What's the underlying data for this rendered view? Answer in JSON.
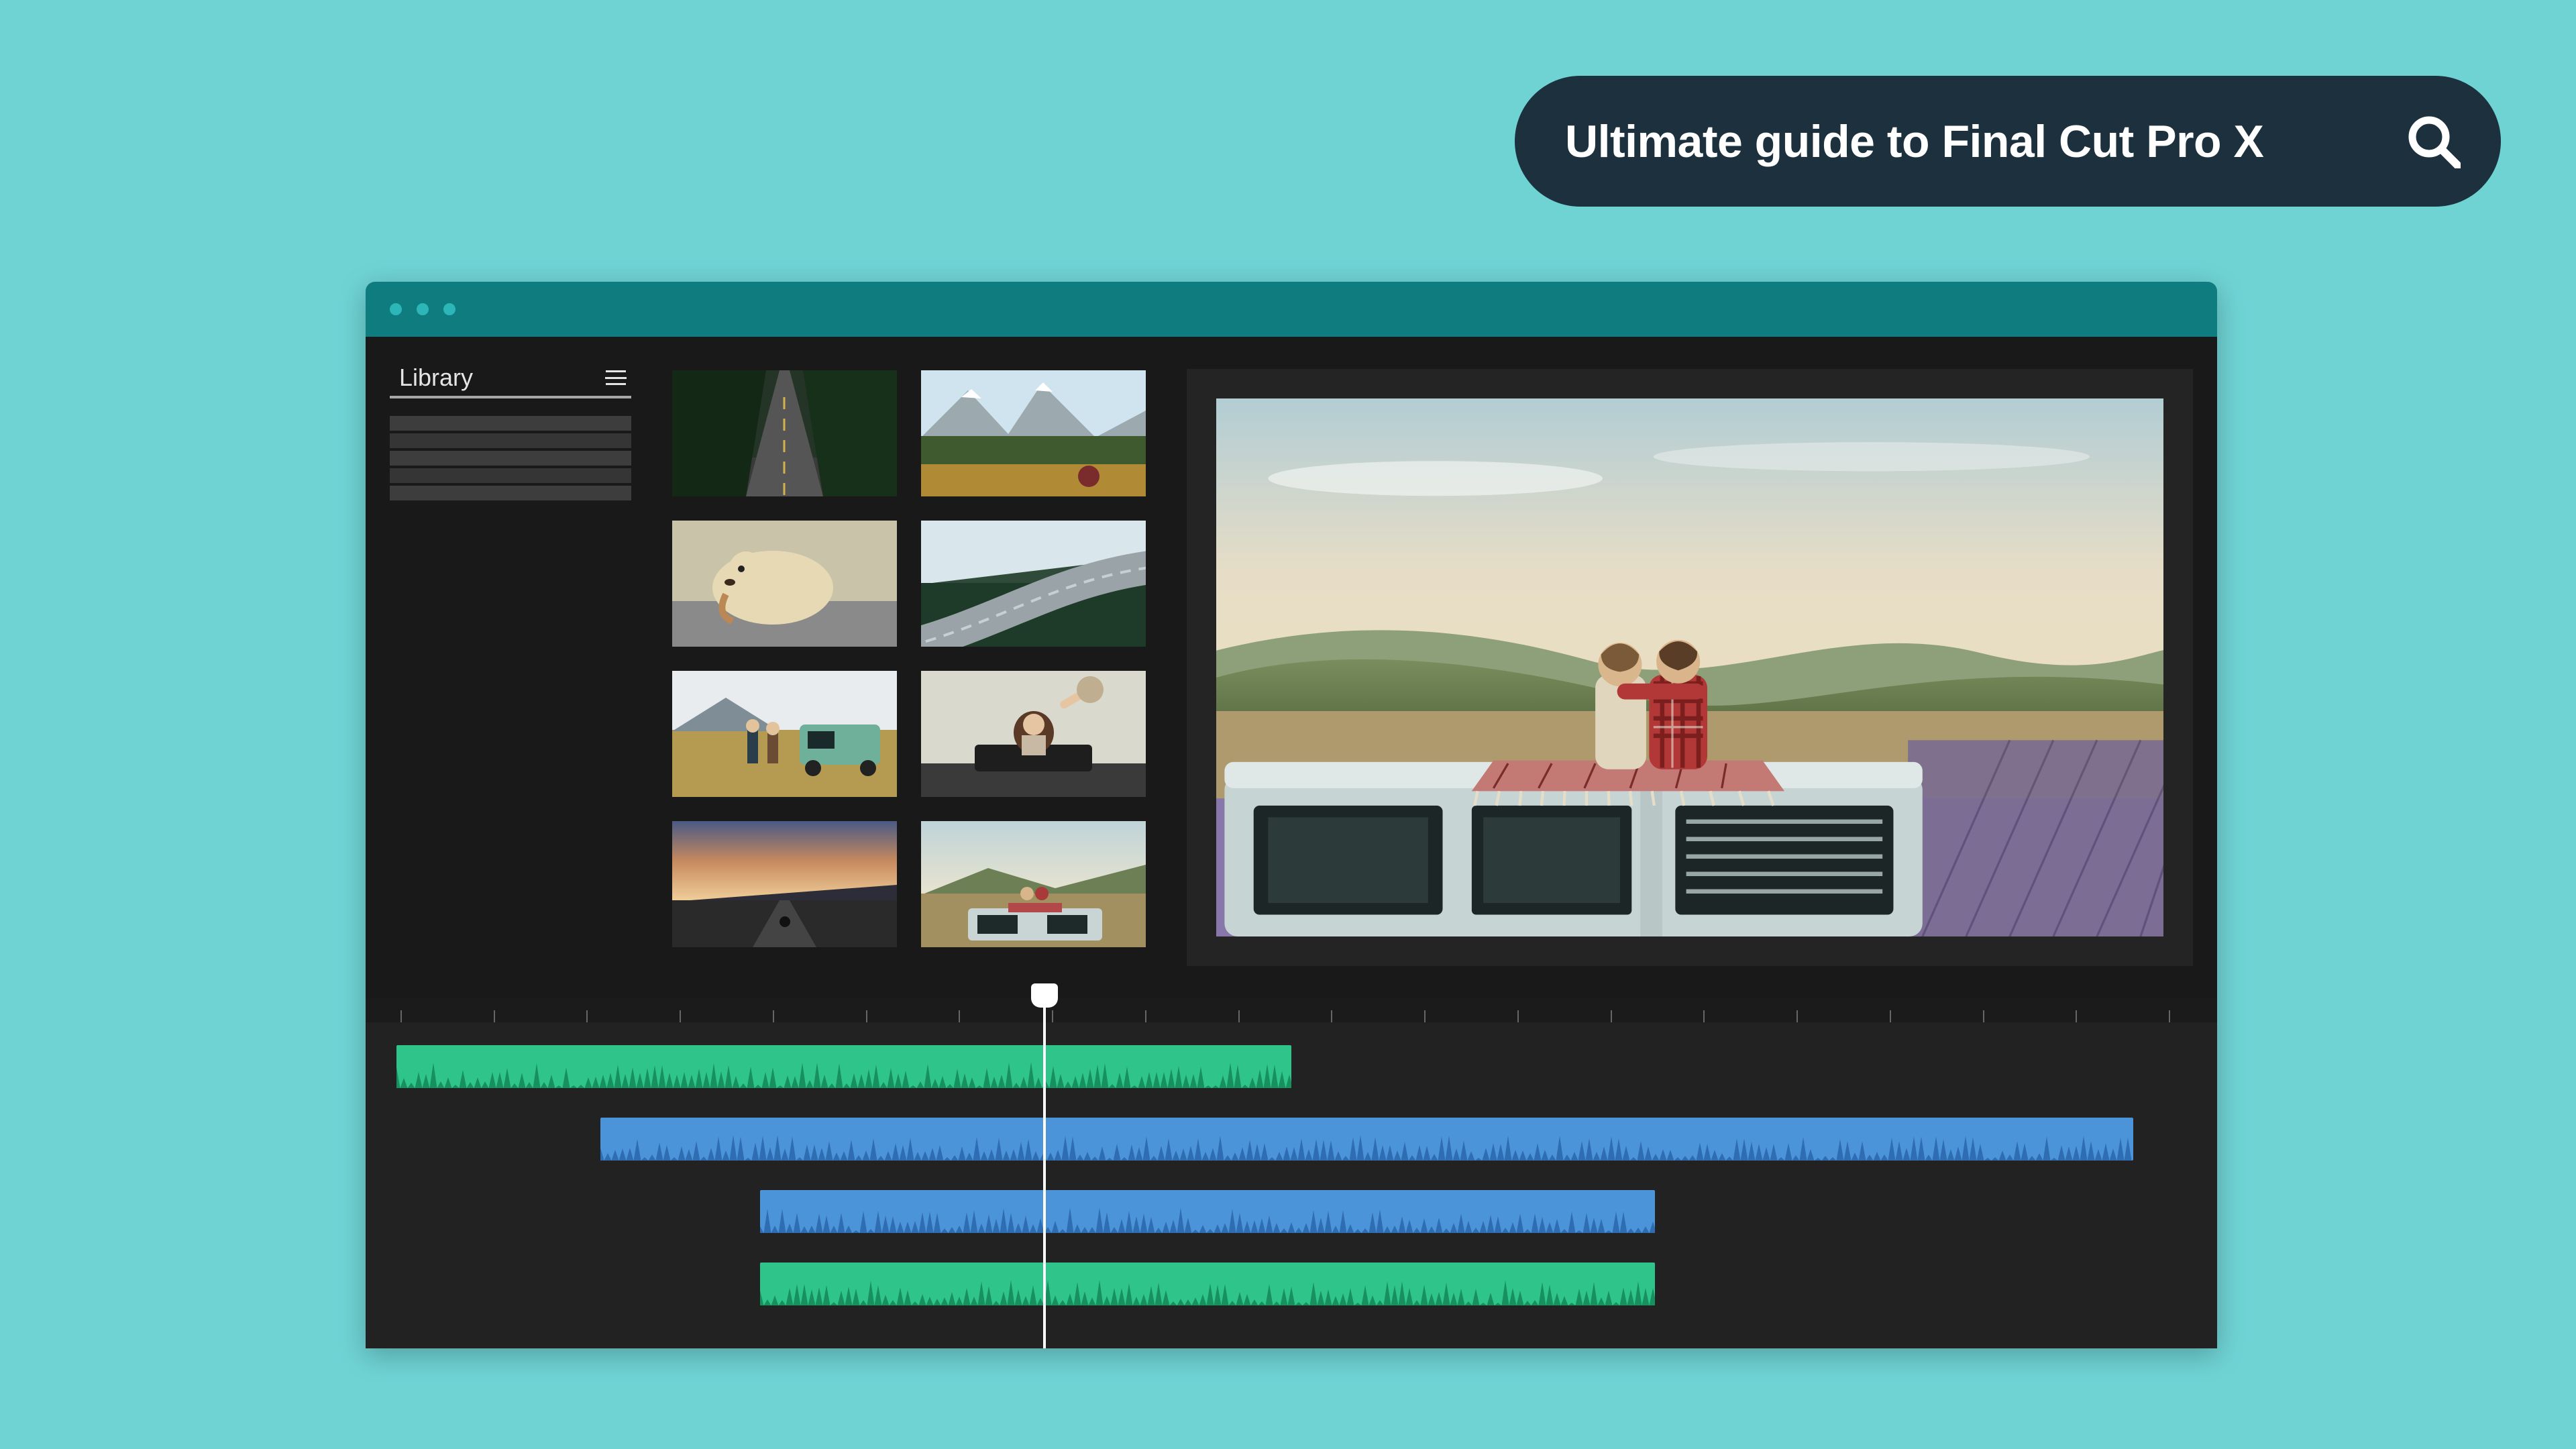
{
  "search": {
    "query": "Ultimate guide to Final Cut Pro X",
    "icon": "search-icon"
  },
  "window": {
    "titlebar_color": "#0f7d80",
    "traffic_dots": 3
  },
  "sidebar": {
    "label": "Library",
    "menu_icon": "hamburger-icon",
    "rows": 5
  },
  "media_bin": {
    "thumbnails": [
      "forest-road",
      "alpine-valley",
      "dog-car-window",
      "coastal-highway",
      "hikers-car",
      "girl-sunroof",
      "sunset-drive",
      "couple-van-roof"
    ]
  },
  "preview": {
    "current_clip": "couple-van-roof"
  },
  "timeline": {
    "playhead_position_pct": 36.5,
    "tick_count": 20,
    "tracks": [
      {
        "color": "green",
        "start_pct": 0,
        "width_pct": 50.5
      },
      {
        "color": "blue",
        "start_pct": 11.5,
        "width_pct": 86.5
      },
      {
        "color": "blue",
        "start_pct": 20.5,
        "width_pct": 50.5
      },
      {
        "color": "green",
        "start_pct": 20.5,
        "width_pct": 50.5
      }
    ]
  },
  "colors": {
    "bg": "#6fd3d4",
    "pill": "#1c313d",
    "titlebar": "#0f7d80",
    "app_body": "#191919",
    "timeline": "#222222",
    "clip_green": "#2fc58a",
    "clip_blue": "#4c94d9"
  }
}
